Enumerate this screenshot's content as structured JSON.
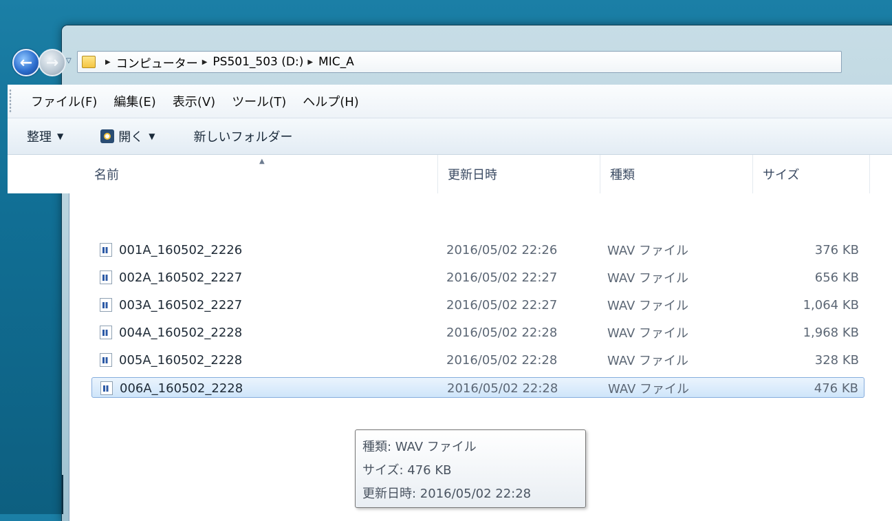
{
  "address": {
    "crumbs": [
      "コンピューター",
      "PS501_503 (D:)",
      "MIC_A"
    ]
  },
  "menu": [
    "ファイル(F)",
    "編集(E)",
    "表示(V)",
    "ツール(T)",
    "ヘルプ(H)"
  ],
  "commands": {
    "organize": "整理",
    "open": "開く",
    "new_folder": "新しいフォルダー"
  },
  "columns": {
    "name": "名前",
    "date": "更新日時",
    "type": "種類",
    "size": "サイズ"
  },
  "files": [
    {
      "name": "001A_160502_2226",
      "date": "2016/05/02 22:26",
      "type": "WAV ファイル",
      "size": "376 KB"
    },
    {
      "name": "002A_160502_2227",
      "date": "2016/05/02 22:27",
      "type": "WAV ファイル",
      "size": "656 KB"
    },
    {
      "name": "003A_160502_2227",
      "date": "2016/05/02 22:27",
      "type": "WAV ファイル",
      "size": "1,064 KB"
    },
    {
      "name": "004A_160502_2228",
      "date": "2016/05/02 22:28",
      "type": "WAV ファイル",
      "size": "1,968 KB"
    },
    {
      "name": "005A_160502_2228",
      "date": "2016/05/02 22:28",
      "type": "WAV ファイル",
      "size": "328 KB"
    },
    {
      "name": "006A_160502_2228",
      "date": "2016/05/02 22:28",
      "type": "WAV ファイル",
      "size": "476 KB",
      "selected": true
    }
  ],
  "tooltip": {
    "type_line": "種類: WAV ファイル",
    "size_line": "サイズ: 476 KB",
    "date_line": "更新日時: 2016/05/02 22:28"
  }
}
